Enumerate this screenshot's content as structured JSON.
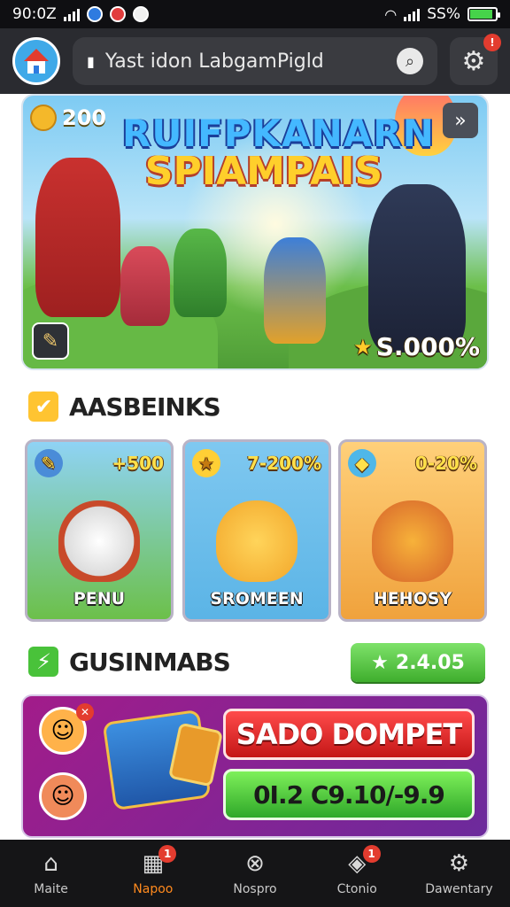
{
  "status_bar": {
    "time": "90:0Z",
    "battery": "SS%"
  },
  "header": {
    "search_label": "Yast idon LabgamPigld"
  },
  "banner": {
    "coins": "200",
    "title_line1": "RUIFPKANARN",
    "title_line2": "SPIAMPAIS",
    "prize": "S.000%"
  },
  "section1": {
    "title": "AASBEINKS",
    "cards": [
      {
        "name": "PENU",
        "value": "+500",
        "bg": "#7ccf5b"
      },
      {
        "name": "SROMEEN",
        "value": "7-200%",
        "bg": "#57b6e8"
      },
      {
        "name": "HEHOSY",
        "value": "0-20%",
        "bg": "#f0a23c"
      }
    ]
  },
  "section2": {
    "title": "GUSINMABS",
    "pill": "2.4.05"
  },
  "promo": {
    "red_button": "SADO DOMPET",
    "green_button": "0I.2 C9.10/-9.9"
  },
  "nav": [
    {
      "label": "Maite",
      "icon": "home-icon"
    },
    {
      "label": "Napoo",
      "icon": "calendar-icon",
      "badge": "1"
    },
    {
      "label": "Nospro",
      "icon": "ball-icon"
    },
    {
      "label": "Ctonio",
      "icon": "tag-icon",
      "badge": "1"
    },
    {
      "label": "Dawentary",
      "icon": "gear-icon"
    }
  ],
  "colors": {
    "accent_orange": "#ff8a1e",
    "green": "#3fae2d",
    "red": "#c41616",
    "header_bg": "#2a2b30"
  }
}
